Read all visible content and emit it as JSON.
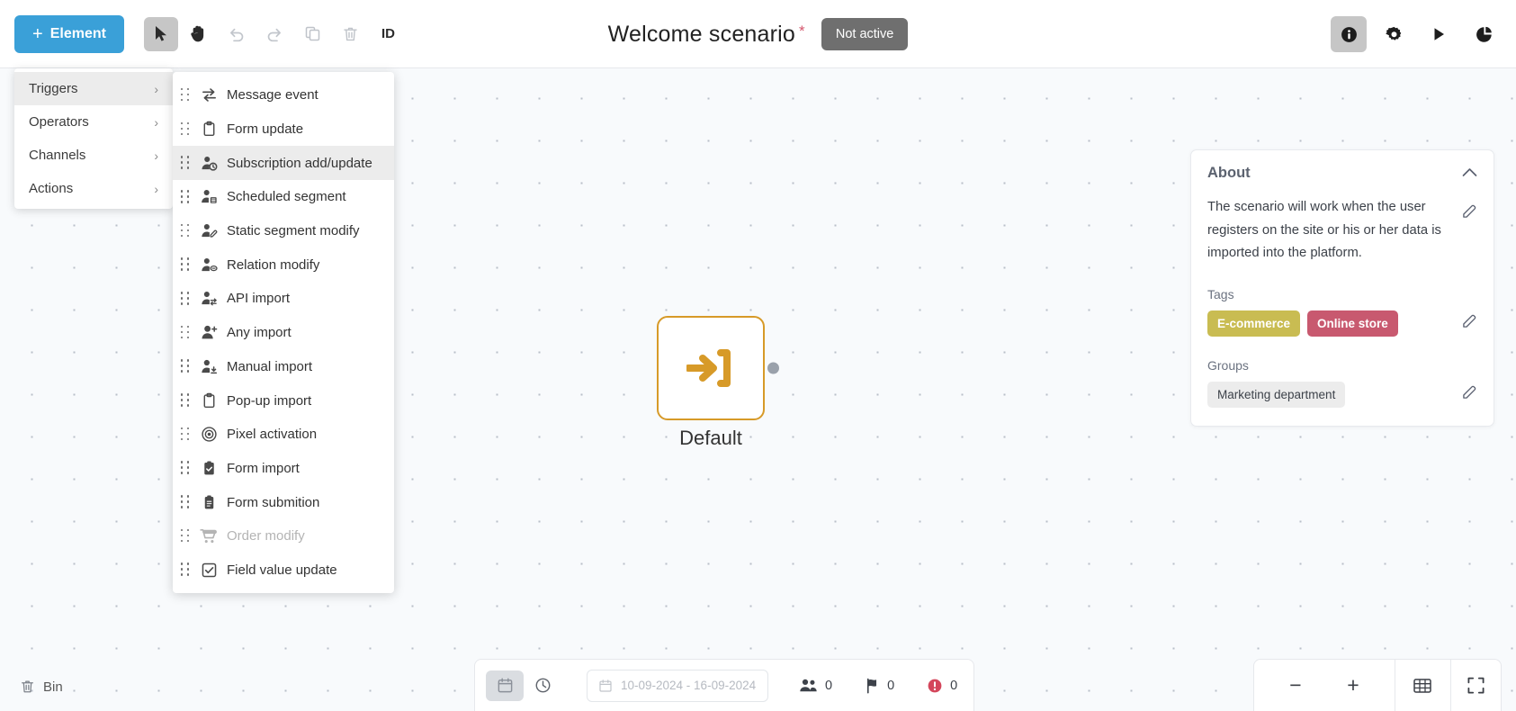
{
  "toolbar": {
    "element_button": "Element",
    "id_button": "ID",
    "tools": [
      {
        "name": "select-tool",
        "icon": "cursor-icon",
        "active": true
      },
      {
        "name": "pan-tool",
        "icon": "hand-icon",
        "active": false
      },
      {
        "name": "undo-tool",
        "icon": "undo-icon",
        "active": false
      },
      {
        "name": "redo-tool",
        "icon": "redo-icon",
        "active": false
      },
      {
        "name": "copy-tool",
        "icon": "copy-icon",
        "active": false
      },
      {
        "name": "delete-tool",
        "icon": "trash-icon",
        "active": false
      }
    ]
  },
  "header": {
    "title": "Welcome scenario",
    "required_mark": "*",
    "status": "Not active"
  },
  "right_tools": [
    {
      "name": "info-button",
      "icon": "info-icon",
      "active": true
    },
    {
      "name": "settings-button",
      "icon": "gear-icon",
      "active": false
    },
    {
      "name": "run-button",
      "icon": "play-icon",
      "active": false
    },
    {
      "name": "stats-button",
      "icon": "pie-chart-icon",
      "active": false
    }
  ],
  "menu": {
    "items": [
      {
        "label": "Triggers",
        "active": true
      },
      {
        "label": "Operators",
        "active": false
      },
      {
        "label": "Channels",
        "active": false
      },
      {
        "label": "Actions",
        "active": false
      }
    ],
    "chevron": "›"
  },
  "submenu": {
    "items": [
      {
        "label": "Message event",
        "icon": "exchange-arrows-icon",
        "active": false,
        "disabled": false
      },
      {
        "label": "Form update",
        "icon": "clipboard-icon",
        "active": false,
        "disabled": false
      },
      {
        "label": "Subscription add/update",
        "icon": "user-clock-icon",
        "active": true,
        "disabled": false
      },
      {
        "label": "Scheduled segment",
        "icon": "user-calendar-icon",
        "active": false,
        "disabled": false
      },
      {
        "label": "Static segment modify",
        "icon": "user-pencil-icon",
        "active": false,
        "disabled": false
      },
      {
        "label": "Relation modify",
        "icon": "user-link-icon",
        "active": false,
        "disabled": false
      },
      {
        "label": "API import",
        "icon": "user-transfer-icon",
        "active": false,
        "disabled": false
      },
      {
        "label": "Any import",
        "icon": "user-plus-icon",
        "active": false,
        "disabled": false
      },
      {
        "label": "Manual import",
        "icon": "user-download-icon",
        "active": false,
        "disabled": false
      },
      {
        "label": "Pop-up import",
        "icon": "clipboard-icon",
        "active": false,
        "disabled": false
      },
      {
        "label": "Pixel activation",
        "icon": "target-icon",
        "active": false,
        "disabled": false
      },
      {
        "label": "Form import",
        "icon": "clipboard-check-icon",
        "active": false,
        "disabled": false
      },
      {
        "label": "Form submition",
        "icon": "clipboard-list-icon",
        "active": false,
        "disabled": false
      },
      {
        "label": "Order modify",
        "icon": "shopping-cart-icon",
        "active": false,
        "disabled": true
      },
      {
        "label": "Field value update",
        "icon": "checkbox-icon",
        "active": false,
        "disabled": false
      }
    ]
  },
  "canvas": {
    "node": {
      "label": "Default",
      "icon": "enter-arrow-icon",
      "accent": "#d79a28"
    }
  },
  "bin": {
    "label": "Bin",
    "icon": "trash-icon"
  },
  "about": {
    "title": "About",
    "collapse_icon": "chevron-up-icon",
    "description": "The scenario will work when the user registers on the site or his or her data is imported into the platform.",
    "tags_label": "Tags",
    "tags": [
      {
        "label": "E-commerce",
        "color": "#c9bc52"
      },
      {
        "label": "Online store",
        "color": "#c8596f"
      }
    ],
    "groups_label": "Groups",
    "groups": [
      {
        "label": "Marketing department",
        "color": "#ececec"
      }
    ],
    "edit_icon": "pencil-icon"
  },
  "bottom_bar": {
    "view_calendar_icon": "calendar-icon",
    "view_clock_icon": "clock-icon",
    "date_range": "10-09-2024 - 16-09-2024",
    "date_icon": "calendar-icon",
    "counters": [
      {
        "name": "contacts-counter",
        "icon": "users-icon",
        "value": "0"
      },
      {
        "name": "goals-counter",
        "icon": "flag-icon",
        "value": "0"
      },
      {
        "name": "errors-counter",
        "icon": "error-icon",
        "value": "0"
      }
    ]
  },
  "zoom_bar": {
    "zoom_out": "−",
    "zoom_in": "+",
    "grid_icon": "grid-icon",
    "fullscreen_icon": "fullscreen-icon"
  }
}
